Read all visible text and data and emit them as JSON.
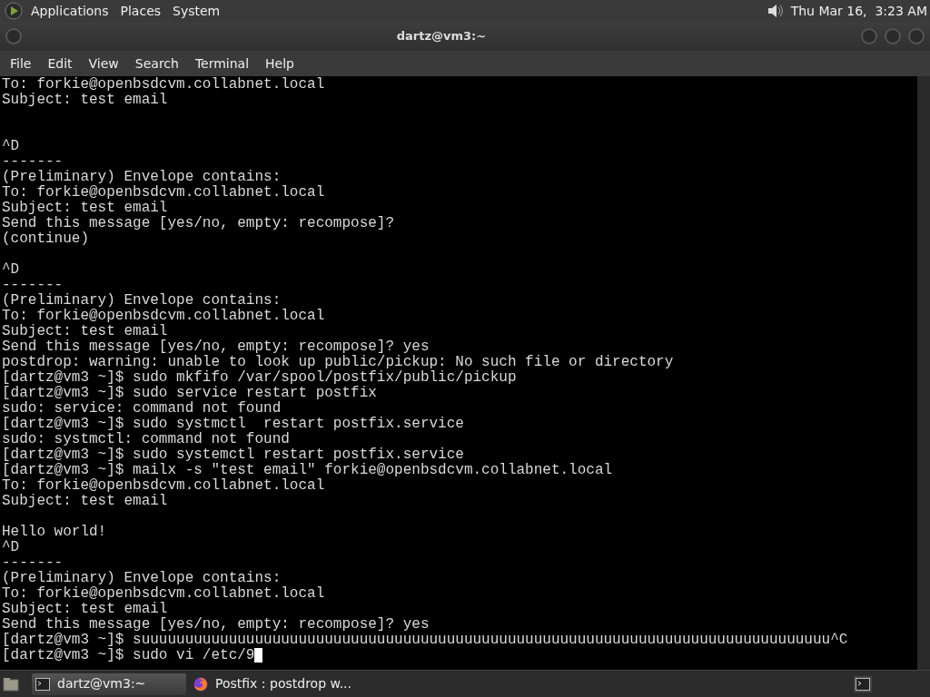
{
  "top_panel": {
    "menus": [
      "Applications",
      "Places",
      "System"
    ],
    "clock": "Thu Mar 16,  3:23 AM"
  },
  "window": {
    "title": "dartz@vm3:~"
  },
  "menu_bar": [
    "File",
    "Edit",
    "View",
    "Search",
    "Terminal",
    "Help"
  ],
  "terminal": {
    "cursor": true,
    "lines": [
      {
        "kind": "text",
        "text": "To: forkie@openbsdcvm.collabnet.local"
      },
      {
        "kind": "text",
        "text": "Subject: test email"
      },
      {
        "kind": "blank"
      },
      {
        "kind": "blank"
      },
      {
        "kind": "text",
        "text": "^D"
      },
      {
        "kind": "text",
        "text": "-------"
      },
      {
        "kind": "text",
        "text": "(Preliminary) Envelope contains:"
      },
      {
        "kind": "text",
        "text": "To: forkie@openbsdcvm.collabnet.local"
      },
      {
        "kind": "text",
        "text": "Subject: test email"
      },
      {
        "kind": "text",
        "text": "Send this message [yes/no, empty: recompose]?"
      },
      {
        "kind": "text",
        "text": "(continue)"
      },
      {
        "kind": "blank"
      },
      {
        "kind": "text",
        "text": "^D"
      },
      {
        "kind": "text",
        "text": "-------"
      },
      {
        "kind": "text",
        "text": "(Preliminary) Envelope contains:"
      },
      {
        "kind": "text",
        "text": "To: forkie@openbsdcvm.collabnet.local"
      },
      {
        "kind": "text",
        "text": "Subject: test email"
      },
      {
        "kind": "text",
        "text": "Send this message [yes/no, empty: recompose]? yes"
      },
      {
        "kind": "text",
        "text": "postdrop: warning: unable to look up public/pickup: No such file or directory"
      },
      {
        "kind": "text",
        "text": "[dartz@vm3 ~]$ sudo mkfifo /var/spool/postfix/public/pickup"
      },
      {
        "kind": "text",
        "text": "[dartz@vm3 ~]$ sudo service restart postfix"
      },
      {
        "kind": "text",
        "text": "sudo: service: command not found"
      },
      {
        "kind": "text",
        "text": "[dartz@vm3 ~]$ sudo systmctl  restart postfix.service"
      },
      {
        "kind": "text",
        "text": "sudo: systmctl: command not found"
      },
      {
        "kind": "text",
        "text": "[dartz@vm3 ~]$ sudo systemctl restart postfix.service"
      },
      {
        "kind": "text",
        "text": "[dartz@vm3 ~]$ mailx -s \"test email\" forkie@openbsdcvm.collabnet.local"
      },
      {
        "kind": "text",
        "text": "To: forkie@openbsdcvm.collabnet.local"
      },
      {
        "kind": "text",
        "text": "Subject: test email"
      },
      {
        "kind": "blank"
      },
      {
        "kind": "text",
        "text": "Hello world!"
      },
      {
        "kind": "text",
        "text": "^D"
      },
      {
        "kind": "text",
        "text": "-------"
      },
      {
        "kind": "text",
        "text": "(Preliminary) Envelope contains:"
      },
      {
        "kind": "text",
        "text": "To: forkie@openbsdcvm.collabnet.local"
      },
      {
        "kind": "text",
        "text": "Subject: test email"
      },
      {
        "kind": "text",
        "text": "Send this message [yes/no, empty: recompose]? yes"
      },
      {
        "kind": "text",
        "text": "[dartz@vm3 ~]$ suuuuuuuuuuuuuuuuuuuuuuuuuuuuuuuuuuuuuuuuuuuuuuuuuuuuuuuuuuuuuuuuuuuuuuuuuuuuuuu^C"
      },
      {
        "kind": "text",
        "text": "[dartz@vm3 ~]$ sudo vi /etc/9"
      }
    ]
  },
  "taskbar": {
    "tasks": [
      {
        "label": "dartz@vm3:~",
        "kind": "terminal",
        "selected": true
      },
      {
        "label": "Postfix : postdrop w...",
        "kind": "browser",
        "selected": false
      }
    ]
  }
}
